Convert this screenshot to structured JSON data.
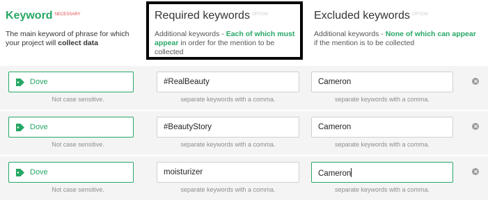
{
  "header": {
    "keyword": {
      "title": "Keyword",
      "badge": "NECESSARY",
      "desc_part1": "The main keyword of phrase for which your project will ",
      "desc_bold": "collect data"
    },
    "required": {
      "title": "Required keywords",
      "badge": "OPTION",
      "desc_part1": "Additional keywords - ",
      "desc_green": "Each of which must appear",
      "desc_part2": " in order for the mention to be collected"
    },
    "excluded": {
      "title": "Excluded keywords",
      "badge": "OPTION",
      "desc_part1": "Additional keywords - ",
      "desc_green": "None of which can appear",
      "desc_part2": " if the mention is to be collected"
    }
  },
  "rows": [
    {
      "keyword": "Dove",
      "keyword_hint": "Not case sensitive.",
      "required": "#RealBeauty",
      "required_hint": "separate keywords with a comma.",
      "excluded": "Cameron",
      "excluded_hint": "separate keywords with a comma."
    },
    {
      "keyword": "Dove",
      "keyword_hint": "Not case sensitive.",
      "required": "#BeautyStory",
      "required_hint": "separate keywords with a comma.",
      "excluded": "Cameron",
      "excluded_hint": "separate keywords with a comma."
    },
    {
      "keyword": "Dove",
      "keyword_hint": "Not case sensitive.",
      "required": "moisturizer",
      "required_hint": "separate keywords with a comma.",
      "excluded": "Cameron",
      "excluded_hint": "separate keywords with a comma."
    }
  ],
  "icons": {
    "tag": "tag-icon",
    "remove": "close-circle-icon"
  },
  "colors": {
    "accent": "#27a766",
    "necessary": "#e0474c",
    "highlight_border": "#000000",
    "row_band": "#f4f4f4"
  }
}
